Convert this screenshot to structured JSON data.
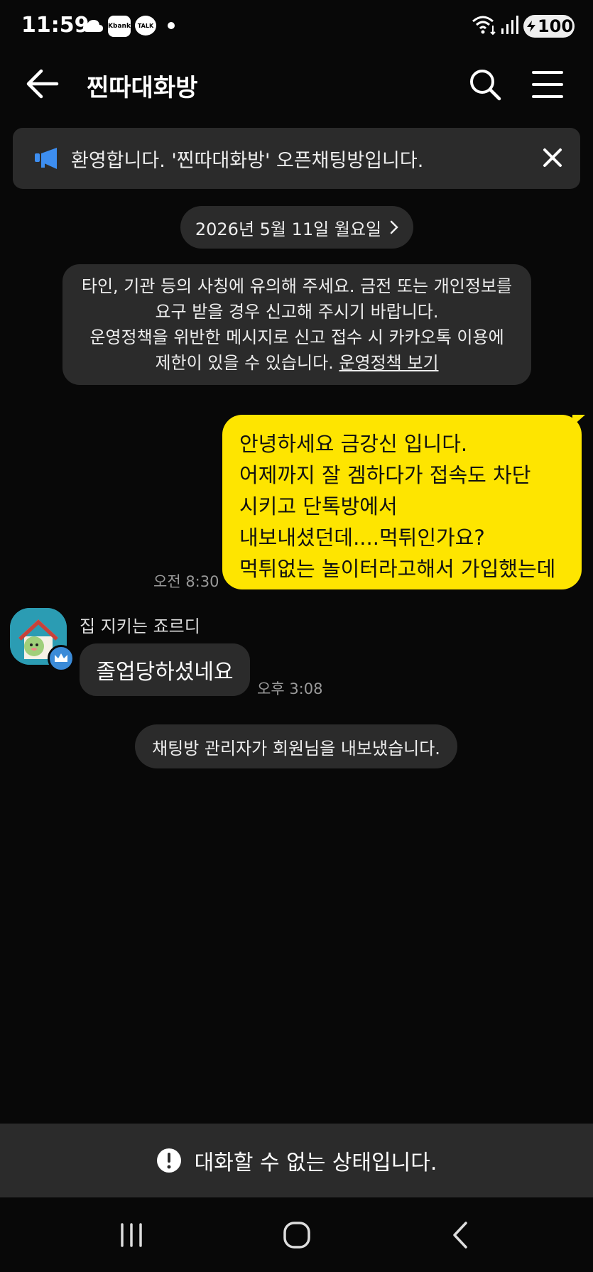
{
  "status_bar": {
    "time": "11:59",
    "kbank_label": "Kbank",
    "talk_label": "TALK",
    "battery": "100"
  },
  "header": {
    "title": "찐따대화방"
  },
  "notice": {
    "text": "환영합니다. '찐따대화방' 오픈채팅방입니다."
  },
  "date_pill": {
    "text": "2026년 5월 11일 월요일"
  },
  "warning": {
    "line1": "타인, 기관 등의 사칭에 유의해 주세요. 금전 또는 개인정보를",
    "line2": "요구 받을 경우 신고해 주시기 바랍니다.",
    "line3": "운영정책을 위반한 메시지로 신고 접수 시 카카오톡 이용에",
    "line4_prefix": "제한이 있을 수 있습니다. ",
    "link": "운영정책 보기"
  },
  "messages": {
    "mine": {
      "lines": [
        "안녕하세요 금강신 입니다.",
        "어제까지 잘 겜하다가 접속도 차단",
        "시키고 단톡방에서",
        "내보내셨던데....먹튀인가요?",
        "먹튀없는 놀이터라고해서 가입했는데"
      ],
      "time": "오전 8:30"
    },
    "received": {
      "sender": "집 지키는 죠르디",
      "text": "졸업당하셨네요",
      "time": "오후 3:08"
    },
    "system": "채팅방 관리자가 회원님을 내보냈습니다."
  },
  "bottom_bar": {
    "text": "대화할 수 없는 상태입니다."
  },
  "colors": {
    "background": "#080808",
    "my_bubble": "#fee500",
    "other_bubble": "#2b2b2b",
    "notice_icon": "#3d8ef0"
  }
}
